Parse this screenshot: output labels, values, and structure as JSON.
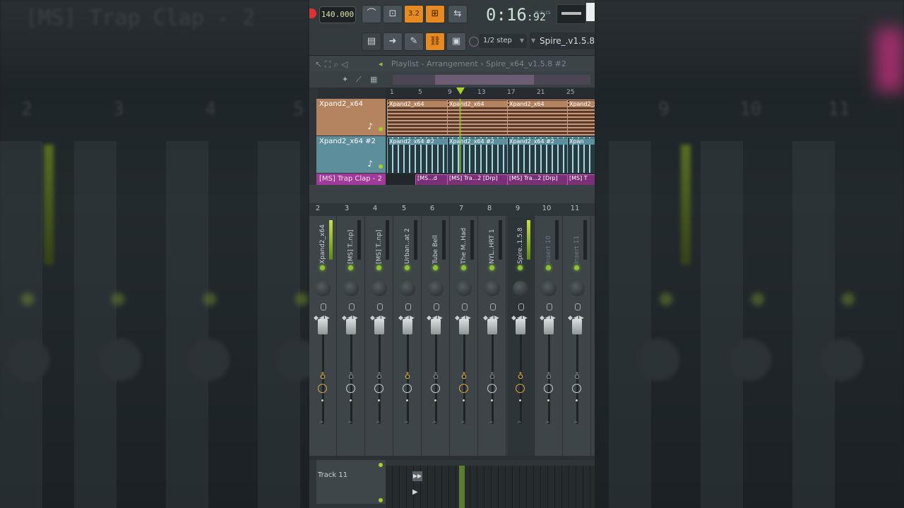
{
  "toolbar": {
    "tempo": "140.000",
    "timecode_main": "0:16",
    "timecode_frac": ":92",
    "timecode_unit": "M:S:CS",
    "pattern_button": "3.2",
    "snap": "1/2 step",
    "plugin": "Spire_.v1.5.8"
  },
  "playlist": {
    "title": "Playlist - Arrangement › Spire_x64_v1.5.8 #2",
    "ruler": [
      "1",
      "5",
      "9",
      "13",
      "17",
      "21",
      "25"
    ],
    "tracks": [
      {
        "name": "Xpand2_x64",
        "color": "#b48460"
      },
      {
        "name": "Xpand2_x64 #2",
        "color": "#5d8e9b"
      },
      {
        "name": "[MS] Trap Clap - 2",
        "color": "#a03b9a"
      }
    ],
    "clips_track1": [
      "Xpand2_x64",
      "Xpand2_x64",
      "Xpand2_x64",
      "Xpand2_x64",
      "Xpan"
    ],
    "clips_track2": [
      "Xpand2_x64 #2",
      "Xpand2_x64 #2",
      "Xpand2_x64 #2",
      "Xpan"
    ],
    "clips_track3": [
      "[MS...d",
      "[MS] Tra...2 [Drp]",
      "[MS] Tra...2 [Drp]",
      "[MS] T"
    ]
  },
  "mixer": {
    "channel_numbers": [
      "2",
      "3",
      "4",
      "5",
      "6",
      "7",
      "8",
      "9",
      "10",
      "11"
    ],
    "channels": [
      {
        "name": "Xpand2_x64"
      },
      {
        "name": "[MS] T..np]"
      },
      {
        "name": "[MS] T..np]"
      },
      {
        "name": "Urban..at 2"
      },
      {
        "name": "Tube Bell"
      },
      {
        "name": "The M..Had"
      },
      {
        "name": "NYL..HRT 1"
      },
      {
        "name": "Spire..1.5.8"
      },
      {
        "name": "Insert 10"
      },
      {
        "name": "Insert 11"
      }
    ]
  },
  "bottom": {
    "track_label": "Track 11"
  },
  "background_text": {
    "left_title": "[MS] Trap Clap - 2",
    "left_numbers": [
      "2",
      "3",
      "4",
      "5"
    ],
    "right_numbers": [
      "9",
      "10",
      "11"
    ]
  }
}
